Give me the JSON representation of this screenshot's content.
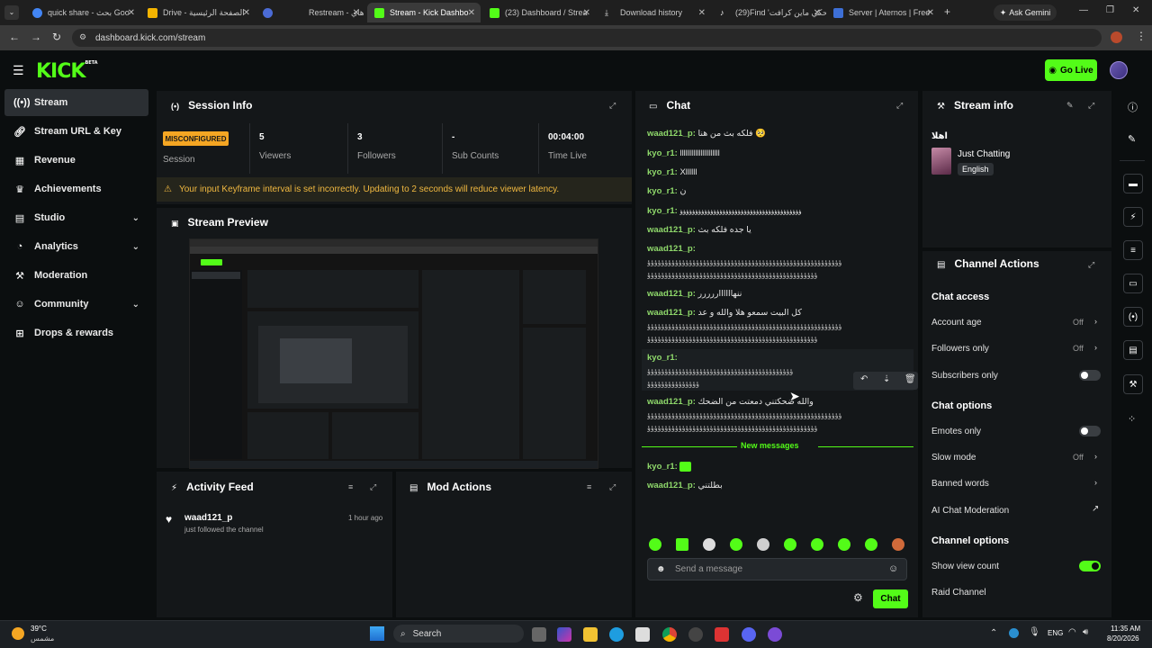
{
  "browser": {
    "tabs": [
      {
        "title": "quick share - بحث Goo",
        "color": "#4285f4"
      },
      {
        "title": "Drive - الصفحة الرئيسية",
        "color": "#f4b400"
      },
      {
        "title": "",
        "color": "#4b6bd6"
      },
      {
        "title": "Restream - هاي",
        "color": "#5a6cf5"
      },
      {
        "title": "Stream - Kick Dashbo",
        "color": "#53fc18"
      },
      {
        "title": "(23) Dashboard / Strea",
        "color": "#53fc18"
      },
      {
        "title": "Download history",
        "color": "#9aa0a6"
      },
      {
        "title": "(29)Find 'تحكي ماين كرافت",
        "color": "#ffffff"
      },
      {
        "title": "Server | Aternos | Free",
        "color": "#3d6fd6"
      }
    ],
    "ask_gemini": "Ask Gemini",
    "url": "dashboard.kick.com/stream"
  },
  "header": {
    "logo": "KICK",
    "logo_beta": "BETA",
    "go_live": "Go Live"
  },
  "sidebar": {
    "items": [
      {
        "label": "Stream",
        "icon": "broadcast-icon"
      },
      {
        "label": "Stream URL & Key",
        "icon": "link-icon"
      },
      {
        "label": "Revenue",
        "icon": "revenue-icon"
      },
      {
        "label": "Achievements",
        "icon": "trophy-icon"
      },
      {
        "label": "Studio",
        "icon": "studio-icon"
      },
      {
        "label": "Analytics",
        "icon": "analytics-icon"
      },
      {
        "label": "Moderation",
        "icon": "wrench-icon"
      },
      {
        "label": "Community",
        "icon": "community-icon"
      },
      {
        "label": "Drops & rewards",
        "icon": "drops-icon"
      }
    ]
  },
  "session": {
    "title": "Session Info",
    "badge": "MISCONFIGURED",
    "session_label": "Session",
    "stats": [
      {
        "value": "5",
        "label": "Viewers"
      },
      {
        "value": "3",
        "label": "Followers"
      },
      {
        "value": "-",
        "label": "Sub Counts"
      },
      {
        "value": "00:04:00",
        "label": "Time Live"
      }
    ],
    "warning": "Your input Keyframe interval is set incorrectly. Updating to 2 seconds will reduce viewer latency."
  },
  "preview": {
    "title": "Stream Preview"
  },
  "activity": {
    "title": "Activity Feed",
    "items": [
      {
        "user": "waad121_p",
        "text": "just followed the channel",
        "time": "1 hour ago"
      }
    ]
  },
  "mod_actions": {
    "title": "Mod Actions"
  },
  "chat": {
    "title": "Chat",
    "messages": [
      {
        "user": "waad121_p:",
        "text": "فلكه بث من هنا 🥺"
      },
      {
        "user": "kyo_r1:",
        "text": "lllllllllllllllllllll"
      },
      {
        "user": "kyo_r1:",
        "text": "Xllllll"
      },
      {
        "user": "kyo_r1:",
        "text": "ن"
      },
      {
        "user": "kyo_r1:",
        "text": "ؤؤؤؤؤؤؤؤؤؤؤؤؤؤؤؤؤؤؤؤؤؤؤؤؤؤؤؤؤؤؤؤؤؤؤؤؤؤؤؤ"
      },
      {
        "user": "waad121_p:",
        "text": "يا جده فلكه بث"
      },
      {
        "user": "waad121_p:",
        "text": ""
      },
      {
        "user": "waad121_p:",
        "text": "ننهااااااررررر"
      },
      {
        "user": "waad121_p:",
        "text": "كل البيت سمعو هلا والله و عد"
      },
      {
        "user": "kyo_r1:",
        "text": ""
      },
      {
        "user": "waad121_p:",
        "text": "والله ضحكتني دمعتت من الضحك"
      }
    ],
    "new_messages": "New messages",
    "after": [
      {
        "user": "kyo_r1:",
        "text": ""
      },
      {
        "user": "waad121_p:",
        "text": "بطلتني"
      }
    ],
    "placeholder": "Send a message",
    "send": "Chat"
  },
  "stream_info": {
    "title": "Stream info",
    "stream_title": "اهلا",
    "category": "Just Chatting",
    "language": "English"
  },
  "channel_actions": {
    "title": "Channel Actions",
    "chat_access": "Chat access",
    "account_age": "Account age",
    "account_age_value": "Off",
    "followers_only": "Followers only",
    "followers_only_value": "Off",
    "subscribers_only": "Subscribers only",
    "chat_options": "Chat options",
    "emotes_only": "Emotes only",
    "slow_mode": "Slow mode",
    "slow_mode_value": "Off",
    "banned_words": "Banned words",
    "ai_moderation": "AI Chat Moderation",
    "channel_options": "Channel options",
    "show_view_count": "Show view count",
    "raid_channel": "Raid Channel"
  },
  "taskbar": {
    "temp": "39°C",
    "weather": "مشمس",
    "search": "Search",
    "lang": "ENG",
    "time": "11:35 AM",
    "date": "8/20/2026"
  }
}
